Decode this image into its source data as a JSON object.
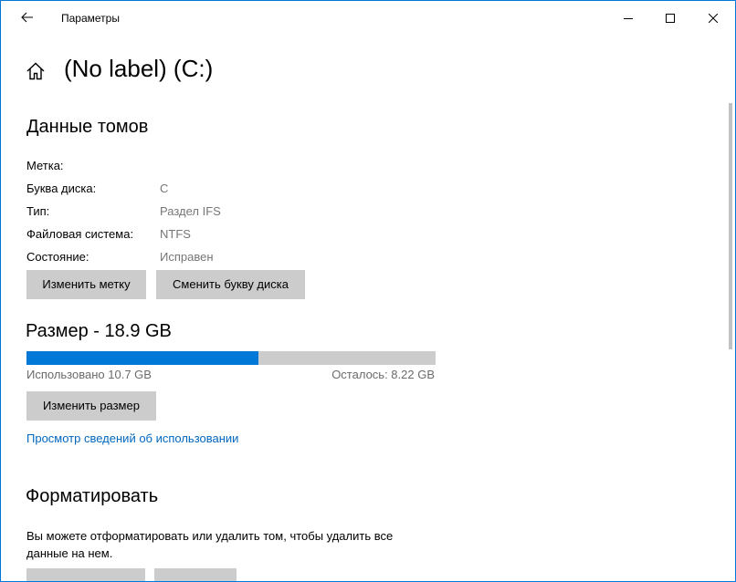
{
  "window": {
    "title": "Параметры",
    "controls": {
      "minimize": "minimize",
      "maximize": "maximize",
      "close": "close"
    }
  },
  "page": {
    "title": "(No label) (C:)"
  },
  "volume_data": {
    "heading": "Данные томов",
    "properties": [
      {
        "label": "Метка:",
        "value": ""
      },
      {
        "label": "Буква диска:",
        "value": "C"
      },
      {
        "label": "Тип:",
        "value": "Раздел IFS"
      },
      {
        "label": "Файловая система:",
        "value": "NTFS"
      },
      {
        "label": "Состояние:",
        "value": "Исправен"
      }
    ],
    "change_label_button": "Изменить метку",
    "change_letter_button": "Сменить букву диска"
  },
  "size": {
    "heading": "Размер - 18.9 GB",
    "used_text": "Использовано 10.7 GB",
    "free_text": "Осталось: 8.22 GB",
    "used_fraction": 0.566,
    "resize_button": "Изменить размер",
    "usage_link": "Просмотр сведений об использовании"
  },
  "format": {
    "heading": "Форматировать",
    "description": "Вы можете отформатировать или удалить том, чтобы удалить все данные на нем."
  },
  "colors": {
    "accent": "#0078d7",
    "button_bg": "#cccccc",
    "link": "#0067c0",
    "muted_text": "#767676"
  }
}
